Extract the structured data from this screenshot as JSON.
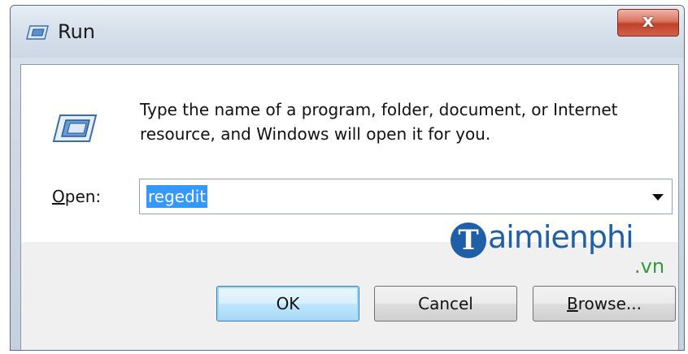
{
  "window": {
    "title": "Run",
    "close_label": "x",
    "title_icon": "run-icon"
  },
  "dialog": {
    "description": "Type the name of a program, folder, document, or Internet resource, and Windows will open it for you.",
    "open_label_accel": "O",
    "open_label_rest": "pen:",
    "open_value": "regedit",
    "big_icon": "run-icon"
  },
  "watermark": {
    "glyph": "T",
    "text": "aimienphi",
    "suffix": ".vn"
  },
  "buttons": {
    "ok": "OK",
    "cancel": "Cancel",
    "browse_accel": "B",
    "browse_rest": "rowse..."
  },
  "colors": {
    "selection": "#3399ff",
    "close_button": "#c0412a",
    "watermark_blue": "#1f5fa8",
    "watermark_green": "#2e9a3a"
  }
}
